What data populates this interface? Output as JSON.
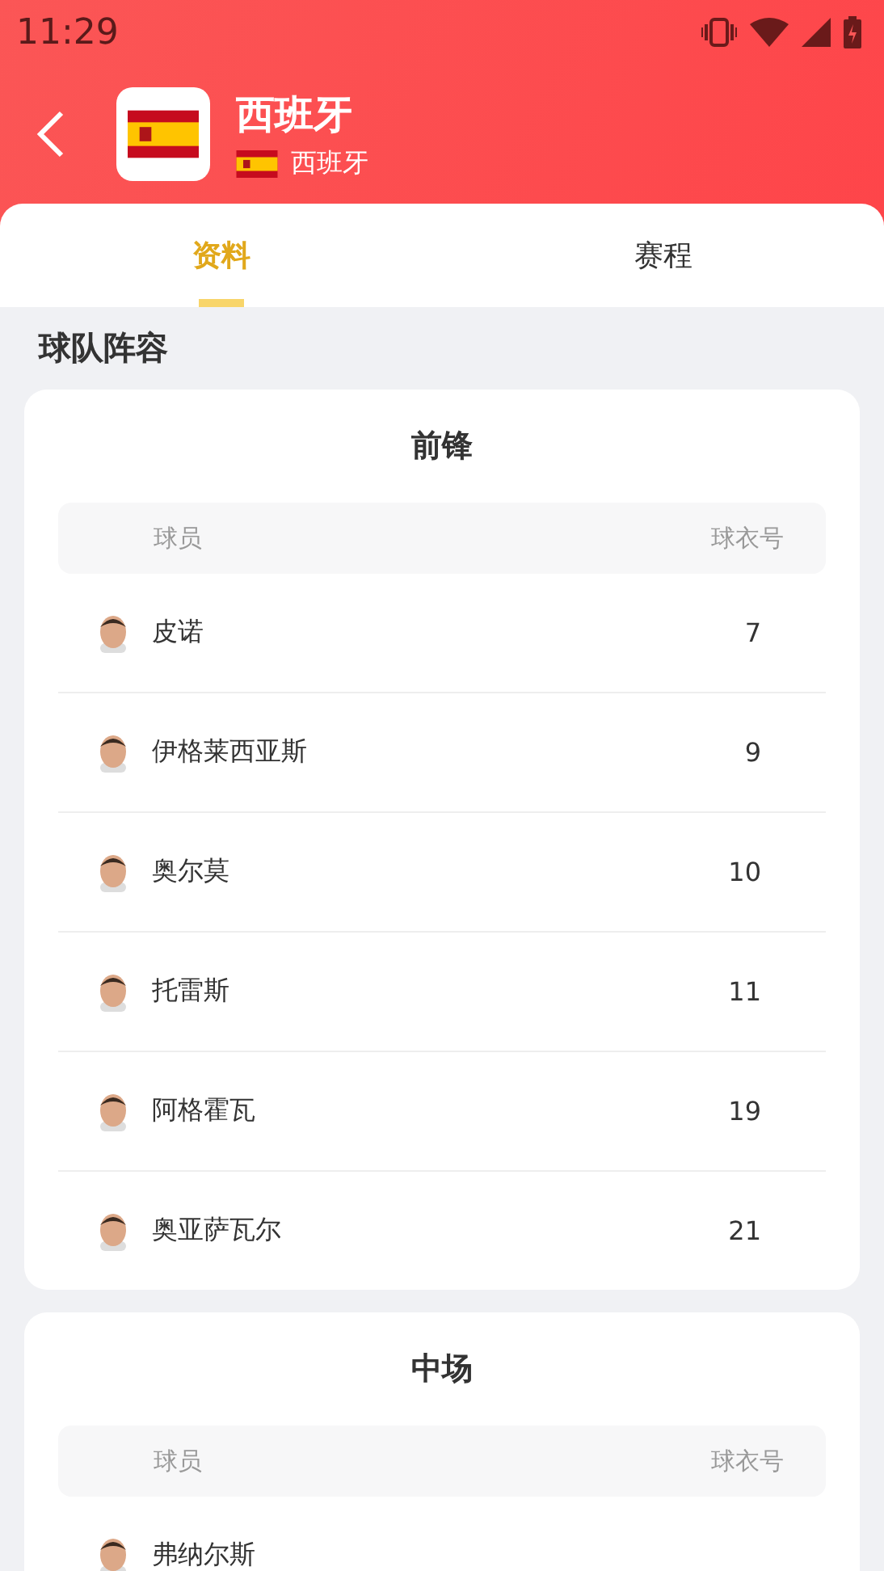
{
  "status_bar": {
    "time": "11:29"
  },
  "header": {
    "title": "西班牙",
    "subtitle": "西班牙"
  },
  "tabs": [
    {
      "label": "资料",
      "selected": true
    },
    {
      "label": "赛程",
      "selected": false
    }
  ],
  "section_title": "球队阵容",
  "groups": [
    {
      "title": "前锋",
      "columns": [
        "球员",
        "球衣号"
      ],
      "players": [
        {
          "name": "皮诺",
          "number": "7"
        },
        {
          "name": "伊格莱西亚斯",
          "number": "9"
        },
        {
          "name": "奥尔莫",
          "number": "10"
        },
        {
          "name": "托雷斯",
          "number": "11"
        },
        {
          "name": "阿格霍瓦",
          "number": "19"
        },
        {
          "name": "奥亚萨瓦尔",
          "number": "21"
        }
      ]
    },
    {
      "title": "中场",
      "columns": [
        "球员",
        "球衣号"
      ],
      "players": [
        {
          "name": "弗纳尔斯"
        }
      ]
    }
  ]
}
